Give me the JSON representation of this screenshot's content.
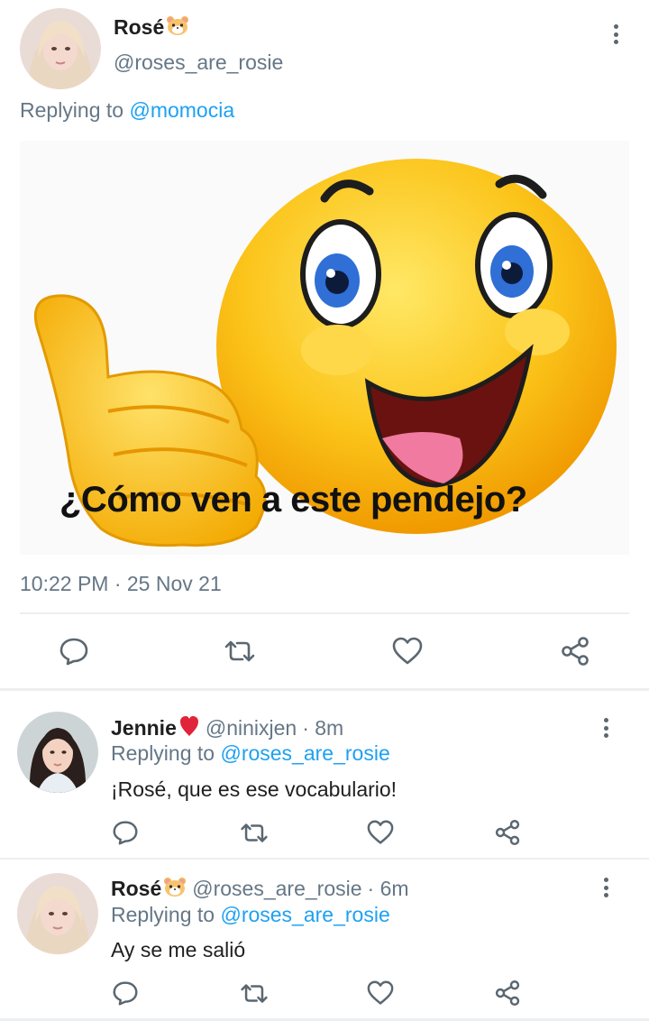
{
  "main_tweet": {
    "name": "Rosé",
    "handle": "@roses_are_rosie",
    "replying_prefix": "Replying to",
    "replying_to": "@momocia",
    "image_caption": "¿Cómo ven a este pendejo?",
    "timestamp": "10:22 PM · 25 Nov 21"
  },
  "replies": [
    {
      "name": "Jennie",
      "handle": "@ninixjen",
      "time": "· 8m",
      "replying_prefix": "Replying to",
      "replying_to": "@roses_are_rosie",
      "text": "¡Rosé, que es ese vocabulario!"
    },
    {
      "name": "Rosé",
      "handle": "@roses_are_rosie",
      "time": "· 6m",
      "replying_prefix": "Replying to",
      "replying_to": "@roses_are_rosie",
      "text": "Ay se me salió"
    }
  ],
  "icons": {
    "reply": "comment-icon",
    "retweet": "retweet-icon",
    "like": "heart-icon",
    "share": "share-icon",
    "menu": "more-vertical-icon"
  },
  "colors": {
    "link": "#1da1f2",
    "meta": "#657786",
    "icon": "#5b6770",
    "emoji_yellow": "#f7b600"
  }
}
